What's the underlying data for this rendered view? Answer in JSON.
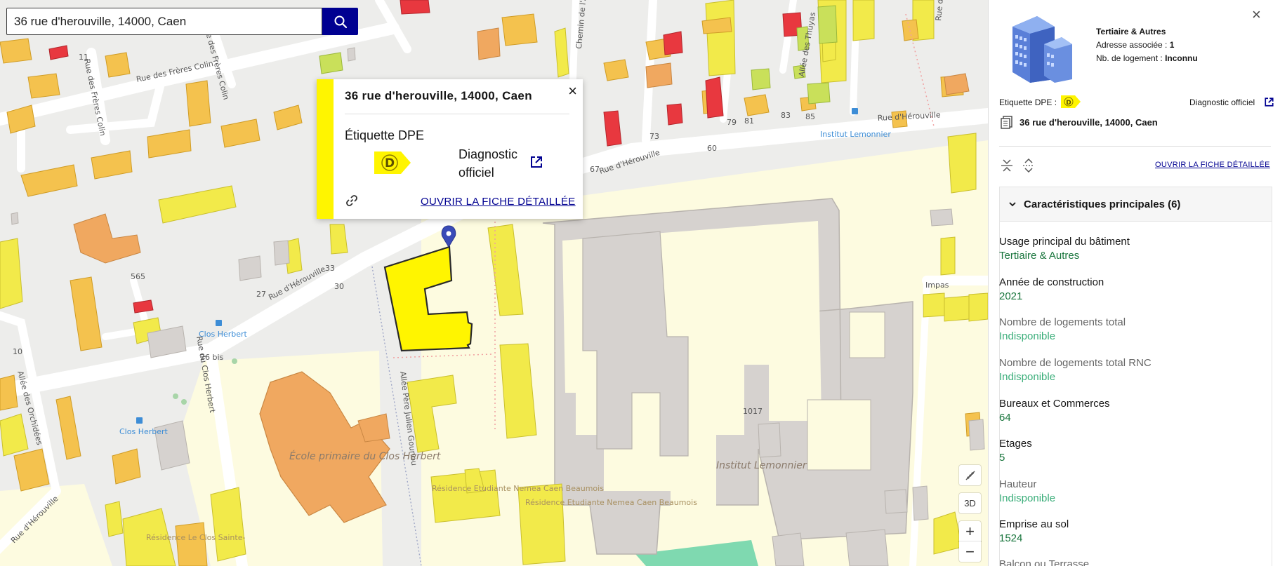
{
  "search": {
    "value": "36 rue d'herouville, 14000, Caen",
    "icon": "search-icon"
  },
  "map_labels": {
    "rue_freres_colin_h": "Rue des Frères Colin",
    "rue_freres_colin_v1": "Rue des Frères Colin",
    "rue_freres_colin_v2": "Rue des Frères Colin",
    "rue_herouville_1": "Rue d'Hérouville",
    "rue_herouville_2": "Rue d'Hérouville",
    "rue_herouville_3": "Rue d'Hérouville",
    "rue_herouville_4": "Rue d'Hérouville",
    "allee_thuyas": "Allée des Thuyas",
    "chemin": "Chemin de l'Ab",
    "rue_arc": "Rue de l'Arc",
    "institut_stop": "Institut Lemonnier",
    "clos_herbert_1": "Clos Herbert",
    "clos_herbert_2": "Clos Herbert",
    "rue_clos_herbert": "Rue du Clos Herbert",
    "allee_orchidees": "Allée des Orchidées",
    "allee_pere": "Allée Père Julien Gouriou",
    "ecole": "École primaire du Clos Herbert",
    "institut_map": "Institut Lemonnier",
    "residence_1": "Résidence Etudiante Nemea Caen Beaumois",
    "residence_2": "Résidence Etudiante Nemea Caen Beaumois",
    "residence_3": "Résidence Le Clos Sainte-",
    "impasse": "Impas",
    "num_565": "565",
    "num_1017": "1017",
    "num_26bis": "26 bis",
    "num_27": "27",
    "num_30": "30",
    "num_33": "33",
    "num_60": "60",
    "num_67": "67",
    "num_73": "73",
    "num_79": "79",
    "num_81": "81",
    "num_83": "83",
    "num_85": "85",
    "num_10": "10",
    "num_11": "11"
  },
  "popup": {
    "title": "36 rue d'herouville, 14000, Caen",
    "close": "×",
    "dpe_label": "Étiquette DPE",
    "dpe_class": "D",
    "diagnostic": "Diagnostic officiel",
    "fiche_link": "OUVRIR LA FICHE DÉTAILLÉE",
    "accent": "#fff500"
  },
  "map_controls": {
    "pitch_icon": "tilt-icon",
    "three_d": "3D",
    "zoom_in": "+",
    "zoom_out": "−"
  },
  "panel": {
    "close": "×",
    "building_type": "Tertiaire & Autres",
    "address_count_label": "Adresse associée : ",
    "address_count": "1",
    "housing_label": "Nb. de logement : ",
    "housing_value": "Inconnu",
    "dpe_label": "Etiquette DPE :",
    "dpe_class": "D",
    "diagnostic": "Diagnostic officiel",
    "address": "36 rue d'herouville, 14000, Caen",
    "fiche_link": "OUVRIR LA FICHE DÉTAILLÉE",
    "accordion_title": "Caractéristiques principales (6)",
    "items": [
      {
        "k": "Usage principal du bâtiment",
        "v": "Tertiaire & Autres",
        "dim": false
      },
      {
        "k": "Année de construction",
        "v": "2021",
        "dim": false
      },
      {
        "k": "Nombre de logements total",
        "v": "Indisponible",
        "dim": true
      },
      {
        "k": "Nombre de logements total RNC",
        "v": "Indisponible",
        "dim": true
      },
      {
        "k": "Bureaux et Commerces",
        "v": "64",
        "dim": false
      },
      {
        "k": "Etages",
        "v": "5",
        "dim": false
      },
      {
        "k": "Hauteur",
        "v": "Indisponible",
        "dim": true
      },
      {
        "k": "Emprise au sol",
        "v": "1524",
        "dim": false
      },
      {
        "k": "Balcon ou Terrasse",
        "v": "",
        "dim": false
      }
    ]
  },
  "colors": {
    "primary": "#000091",
    "dpe_d": "#fff500",
    "value_green": "#18753c"
  }
}
